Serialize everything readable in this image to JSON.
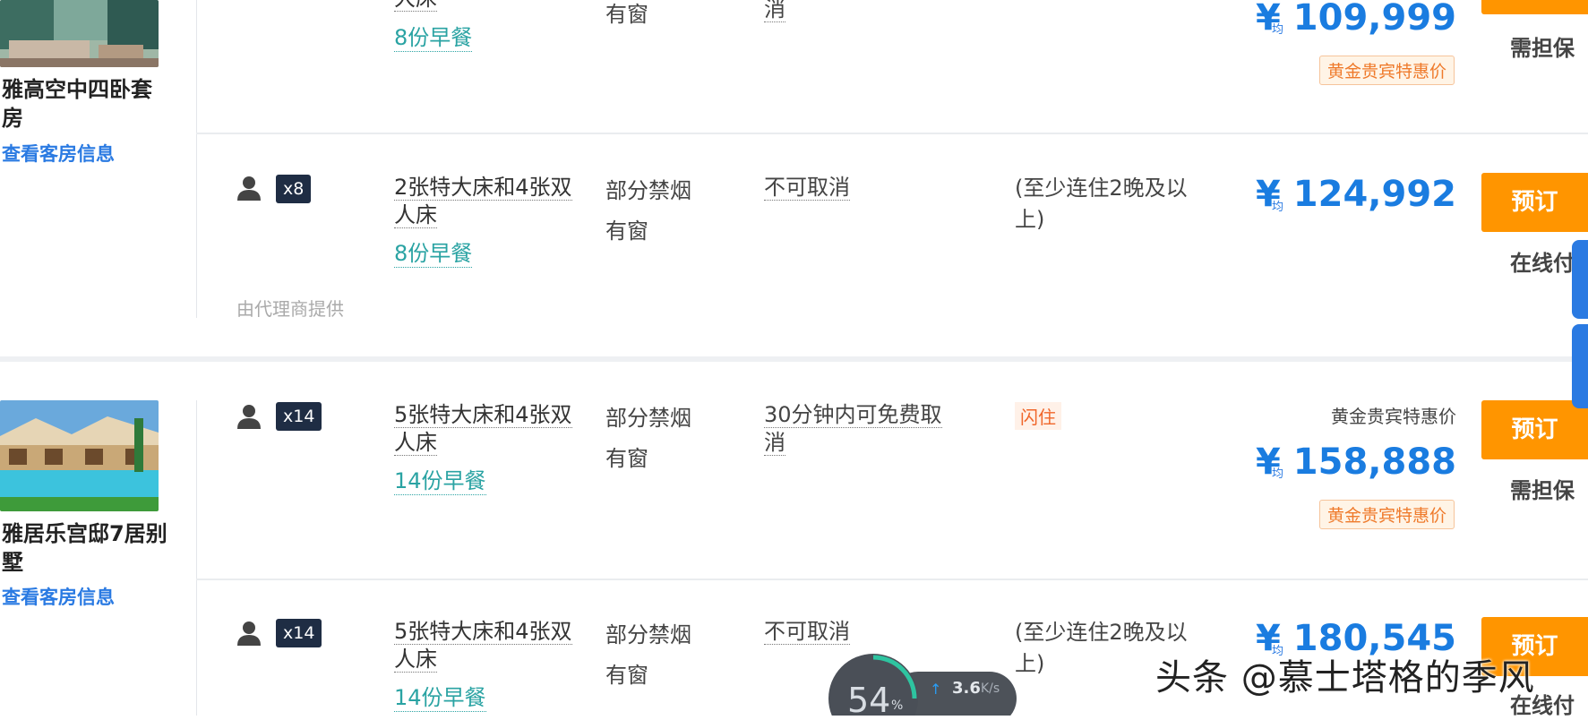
{
  "rooms": [
    {
      "name": "雅高空中四卧套房",
      "view_info": "查看客房信息",
      "offers": [
        {
          "breakfast": "8份早餐",
          "policy": "有窗",
          "cancel": "消",
          "price": "¥ 109,999",
          "avg": "均",
          "tag": "黄金贵宾特惠价",
          "book": "预订",
          "pay": "需担保"
        },
        {
          "occupancy": "x8",
          "bed": "2张特大床和4张双人床",
          "breakfast": "8份早餐",
          "smoking": "部分禁烟",
          "window": "有窗",
          "cancel": "不可取消",
          "note": "(至少连住2晚及以上)",
          "avg": "均",
          "price": "¥ 124,992",
          "book": "预订",
          "pay": "在线付",
          "agent": "由代理商提供"
        }
      ]
    },
    {
      "name": "雅居乐宫邸7居别墅",
      "view_info": "查看客房信息",
      "offers": [
        {
          "occupancy": "x14",
          "bed": "5张特大床和4张双人床",
          "breakfast": "14份早餐",
          "smoking": "部分禁烟",
          "window": "有窗",
          "cancel": "30分钟内可免费取消",
          "flash": "闪住",
          "gold_text": "黄金贵宾特惠价",
          "avg": "均",
          "price": "¥ 158,888",
          "tag": "黄金贵宾特惠价",
          "book": "预订",
          "pay": "需担保"
        },
        {
          "occupancy": "x14",
          "bed": "5张特大床和4张双人床",
          "breakfast": "14份早餐",
          "smoking": "部分禁烟",
          "window": "有窗",
          "cancel": "不可取消",
          "note": "(至少连住2晚及以上)",
          "avg": "均",
          "price": "¥ 180,545",
          "book": "预订",
          "pay": "在线付"
        }
      ]
    }
  ],
  "overlay": {
    "watermark": "头条 @慕士塔格的季风",
    "speed_percent": "54",
    "percent_sign": "%",
    "speed_value": "3.6",
    "speed_unit": "K/s"
  },
  "colors": {
    "accent": "#1a7ce0",
    "book_button": "#ff9500",
    "badge": "#1f2d44",
    "breakfast": "#2aa3a3"
  }
}
